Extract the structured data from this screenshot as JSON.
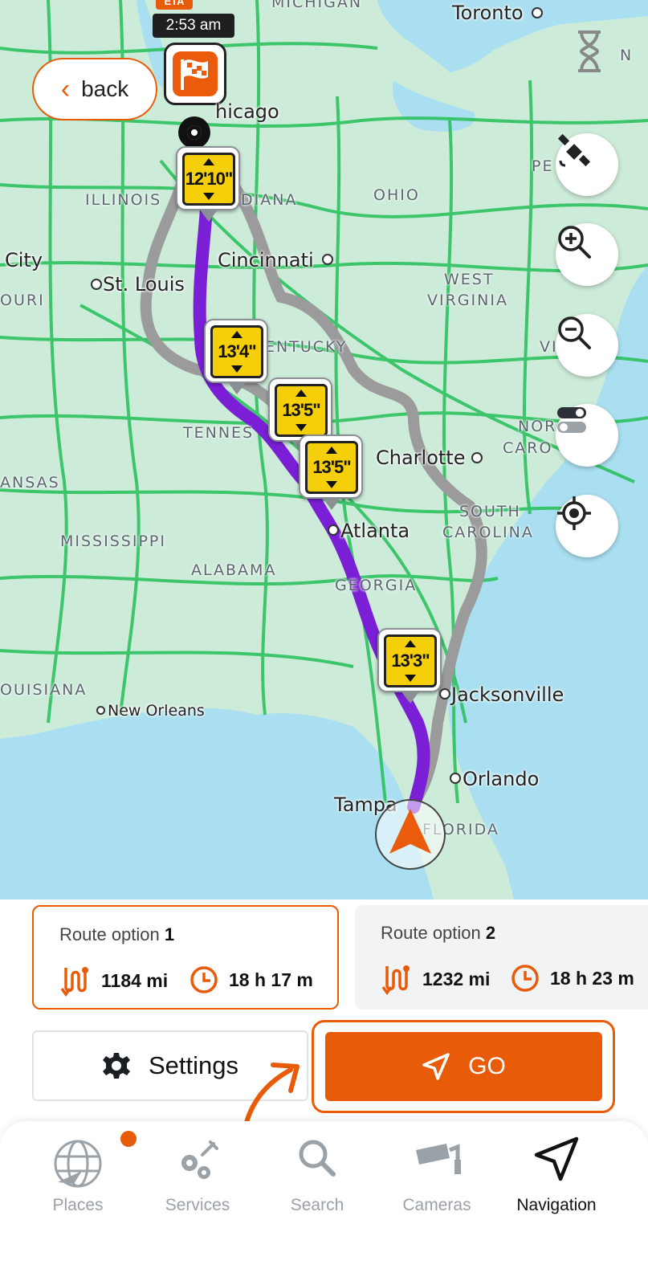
{
  "map": {
    "eta_tag": "ETA",
    "eta_time": "2:53 am",
    "back_label": "back",
    "cities": [
      {
        "name": "Toronto"
      },
      {
        "name": "hicago"
      },
      {
        "name": "Cincinnati"
      },
      {
        "name": "St. Louis"
      },
      {
        "name": "City"
      },
      {
        "name": "Charlotte"
      },
      {
        "name": "Atlanta"
      },
      {
        "name": "Jacksonville"
      },
      {
        "name": "New Orleans"
      },
      {
        "name": "Orlando"
      },
      {
        "name": "Tampa"
      }
    ],
    "states": [
      {
        "name": "MICHIGAN"
      },
      {
        "name": "ILLINOIS"
      },
      {
        "name": "DIANA"
      },
      {
        "name": "OHIO"
      },
      {
        "name": "PE"
      },
      {
        "name": "OURI"
      },
      {
        "name": "WEST"
      },
      {
        "name": "VIRGINIA"
      },
      {
        "name": "ENTUCKY"
      },
      {
        "name": "VIR"
      },
      {
        "name": "TENNES"
      },
      {
        "name": "NOR"
      },
      {
        "name": "CARO"
      },
      {
        "name": "ANSAS"
      },
      {
        "name": "SOUTH"
      },
      {
        "name": "CAROLINA"
      },
      {
        "name": "MISSISSIPPI"
      },
      {
        "name": "ALABAMA"
      },
      {
        "name": "GEORGIA"
      },
      {
        "name": "OUISIANA"
      },
      {
        "name": "FLORIDA"
      },
      {
        "name": "N"
      }
    ],
    "clearances": [
      "12'10\"",
      "13'4\"",
      "13'5\"",
      "13'5\"",
      "13'3\""
    ],
    "controls": [
      "satellite-icon",
      "zoom-in-icon",
      "zoom-out-icon",
      "layers-toggle-icon",
      "locate-icon"
    ],
    "colors": {
      "route_active": "#7a1fd6",
      "route_alt": "#9b9b9b",
      "accent": "#e85b08",
      "land": "#cdebd9",
      "water": "#a9dff0",
      "roads": "#2dc15f"
    }
  },
  "routes": [
    {
      "label": "Route option",
      "number": "1",
      "distance": "1184 mi",
      "duration": "18 h 17 m",
      "selected": true
    },
    {
      "label": "Route option",
      "number": "2",
      "distance": "1232 mi",
      "duration": "18 h 23 m",
      "selected": false
    }
  ],
  "actions": {
    "settings_label": "Settings",
    "go_label": "GO"
  },
  "nav": {
    "items": [
      {
        "label": "Places",
        "icon": "globe-plane-icon",
        "active": false
      },
      {
        "label": "Services",
        "icon": "gears-icon",
        "active": false
      },
      {
        "label": "Search",
        "icon": "search-icon",
        "active": false
      },
      {
        "label": "Cameras",
        "icon": "camera-icon",
        "active": false
      },
      {
        "label": "Navigation",
        "icon": "navigation-arrow-icon",
        "active": true
      }
    ]
  }
}
